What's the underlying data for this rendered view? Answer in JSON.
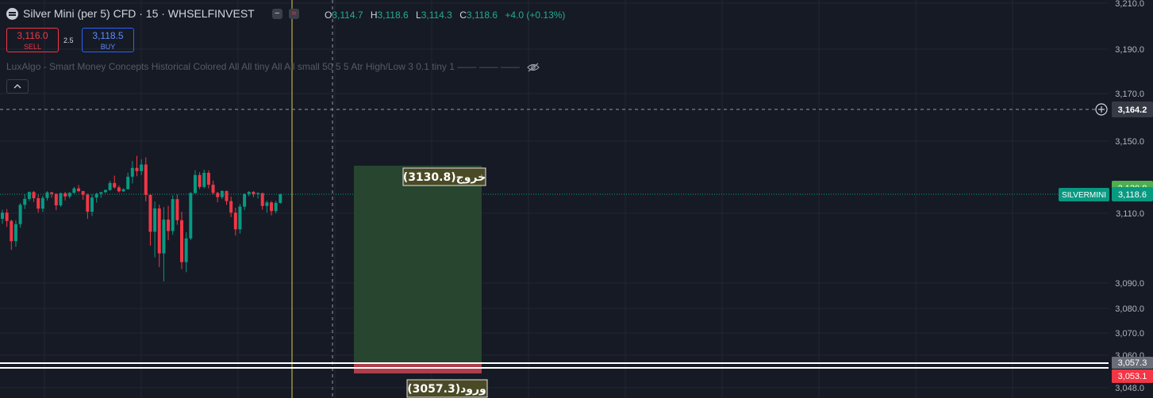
{
  "symbol": {
    "title": "Silver Mini (per 5) CFD · 15 · WHSELFINVEST",
    "icon": "silver-coin-icon"
  },
  "ohlc": {
    "open_label": "O",
    "open": "3,114.7",
    "high_label": "H",
    "high": "3,118.6",
    "low_label": "L",
    "low": "3,114.3",
    "close_label": "C",
    "close": "3,118.6",
    "change": "+4.0 (+0.13%)"
  },
  "trade": {
    "sell_price": "3,116.0",
    "sell_label": "SELL",
    "spread": "2.5",
    "buy_price": "3,118.5",
    "buy_label": "BUY"
  },
  "indicator": {
    "text": "LuxAlgo - Smart Money Concepts Historical Colored All All tiny All All small 50 5 5 Atr High/Low 3 0.1 tiny 1 —— —— ——",
    "visibility_icon": "eye-off-icon"
  },
  "colors": {
    "background": "#161a25",
    "grid": "#232734",
    "up": "#089981",
    "down": "#f23645",
    "profit_zone": "#28452f",
    "loss_zone": "#ae3e4b",
    "label_bg": "#4a4a27",
    "vline": "#e3c653"
  },
  "price_axis": {
    "ticks": [
      "3,210.0",
      "3,190.0",
      "3,170.0",
      "3,150.0",
      "3,110.0",
      "3,090.0",
      "3,080.0",
      "3,070.0",
      "3,060.0",
      "3,048.0"
    ],
    "crosshair_price": "3,164.2",
    "target_price": "3,130.8",
    "last_price": "3,118.6",
    "last_symbol": "SILVERMINI",
    "entry_price": "3,057.3",
    "stop_price": "3,053.1"
  },
  "position": {
    "target_label": "خروج(3130.8)",
    "entry_label": "ورود(3057.3)",
    "target": 3130.8,
    "entry": 3057.3,
    "stop": 3053.1
  },
  "candles": [
    [
      3108.4,
      3111.6,
      3107.0,
      3110.3
    ],
    [
      3110.3,
      3111.9,
      3106.1,
      3107.8
    ],
    [
      3107.8,
      3108.2,
      3099.5,
      3102.0
    ],
    [
      3102.0,
      3108.0,
      3100.4,
      3106.9
    ],
    [
      3106.9,
      3114.6,
      3105.9,
      3113.8
    ],
    [
      3113.8,
      3118.7,
      3111.9,
      3116.5
    ],
    [
      3116.5,
      3124.1,
      3115.6,
      3122.9
    ],
    [
      3122.9,
      3124.9,
      3115.1,
      3116.8
    ],
    [
      3116.8,
      3118.4,
      3110.3,
      3112.1
    ],
    [
      3112.1,
      3117.9,
      3110.6,
      3116.9
    ],
    [
      3116.9,
      3124.6,
      3115.8,
      3122.2
    ],
    [
      3122.2,
      3123.2,
      3117.0,
      3119.4
    ],
    [
      3119.4,
      3120.3,
      3111.4,
      3113.6
    ],
    [
      3113.6,
      3121.8,
      3112.9,
      3120.5
    ],
    [
      3120.5,
      3123.2,
      3115.8,
      3117.6
    ],
    [
      3117.6,
      3122.8,
      3116.7,
      3121.3
    ],
    [
      3121.3,
      3131.2,
      3120.2,
      3129.9
    ],
    [
      3129.9,
      3132.0,
      3122.3,
      3124.6
    ],
    [
      3124.6,
      3125.0,
      3116.1,
      3118.4
    ],
    [
      3118.4,
      3120.2,
      3108.4,
      3110.7
    ],
    [
      3110.7,
      3118.8,
      3109.2,
      3117.1
    ],
    [
      3117.1,
      3121.5,
      3114.8,
      3119.6
    ],
    [
      3119.6,
      3123.4,
      3117.0,
      3122.5
    ],
    [
      3122.5,
      3127.9,
      3120.9,
      3126.7
    ],
    [
      3126.7,
      3133.7,
      3125.2,
      3132.8
    ],
    [
      3132.8,
      3135.8,
      3129.4,
      3131.0
    ],
    [
      3131.0,
      3131.8,
      3122.1,
      3124.2
    ],
    [
      3124.2,
      3129.9,
      3123.0,
      3128.3
    ],
    [
      3128.3,
      3137.1,
      3127.4,
      3135.4
    ],
    [
      3135.4,
      3141.8,
      3132.6,
      3139.0
    ],
    [
      3139.0,
      3144.0,
      3135.6,
      3137.7
    ],
    [
      3137.7,
      3142.6,
      3136.1,
      3140.4
    ],
    [
      3140.4,
      3143.3,
      3115.4,
      3118.3
    ],
    [
      3118.3,
      3119.0,
      3100.7,
      3104.7
    ],
    [
      3104.7,
      3115.3,
      3097.4,
      3112.2
    ],
    [
      3112.2,
      3113.9,
      3094.6,
      3098.5
    ],
    [
      3098.5,
      3112.8,
      3090.5,
      3108.2
    ],
    [
      3108.2,
      3113.4,
      3102.3,
      3104.9
    ],
    [
      3104.9,
      3118.1,
      3103.8,
      3116.4
    ],
    [
      3116.4,
      3118.5,
      3106.7,
      3108.0
    ],
    [
      3108.0,
      3110.7,
      3094.0,
      3096.0
    ],
    [
      3096.0,
      3104.6,
      3093.1,
      3102.8
    ],
    [
      3102.8,
      3122.6,
      3102.3,
      3120.9
    ],
    [
      3120.9,
      3138.1,
      3120.0,
      3136.1
    ],
    [
      3136.1,
      3137.3,
      3128.6,
      3131.2
    ],
    [
      3131.2,
      3138.3,
      3129.9,
      3137.0
    ],
    [
      3137.0,
      3138.0,
      3130.0,
      3132.1
    ],
    [
      3132.1,
      3133.8,
      3118.5,
      3121.2
    ],
    [
      3121.2,
      3123.2,
      3115.0,
      3117.3
    ],
    [
      3117.3,
      3126.1,
      3116.4,
      3124.8
    ],
    [
      3124.8,
      3125.7,
      3113.8,
      3115.5
    ],
    [
      3115.5,
      3117.6,
      3108.9,
      3110.3
    ],
    [
      3110.3,
      3112.5,
      3103.6,
      3105.4
    ],
    [
      3105.4,
      3114.2,
      3104.2,
      3113.0
    ],
    [
      3113.0,
      3120.4,
      3111.4,
      3119.3
    ],
    [
      3119.3,
      3124.7,
      3117.7,
      3123.0
    ],
    [
      3123.0,
      3125.0,
      3117.2,
      3118.9
    ],
    [
      3118.9,
      3122.5,
      3116.6,
      3120.8
    ],
    [
      3120.8,
      3121.1,
      3111.6,
      3113.3
    ],
    [
      3113.3,
      3115.7,
      3110.3,
      3114.9
    ],
    [
      3114.9,
      3115.5,
      3109.4,
      3111.0
    ],
    [
      3111.0,
      3115.6,
      3110.0,
      3114.7
    ],
    [
      3114.7,
      3119.8,
      3114.3,
      3118.6
    ]
  ]
}
